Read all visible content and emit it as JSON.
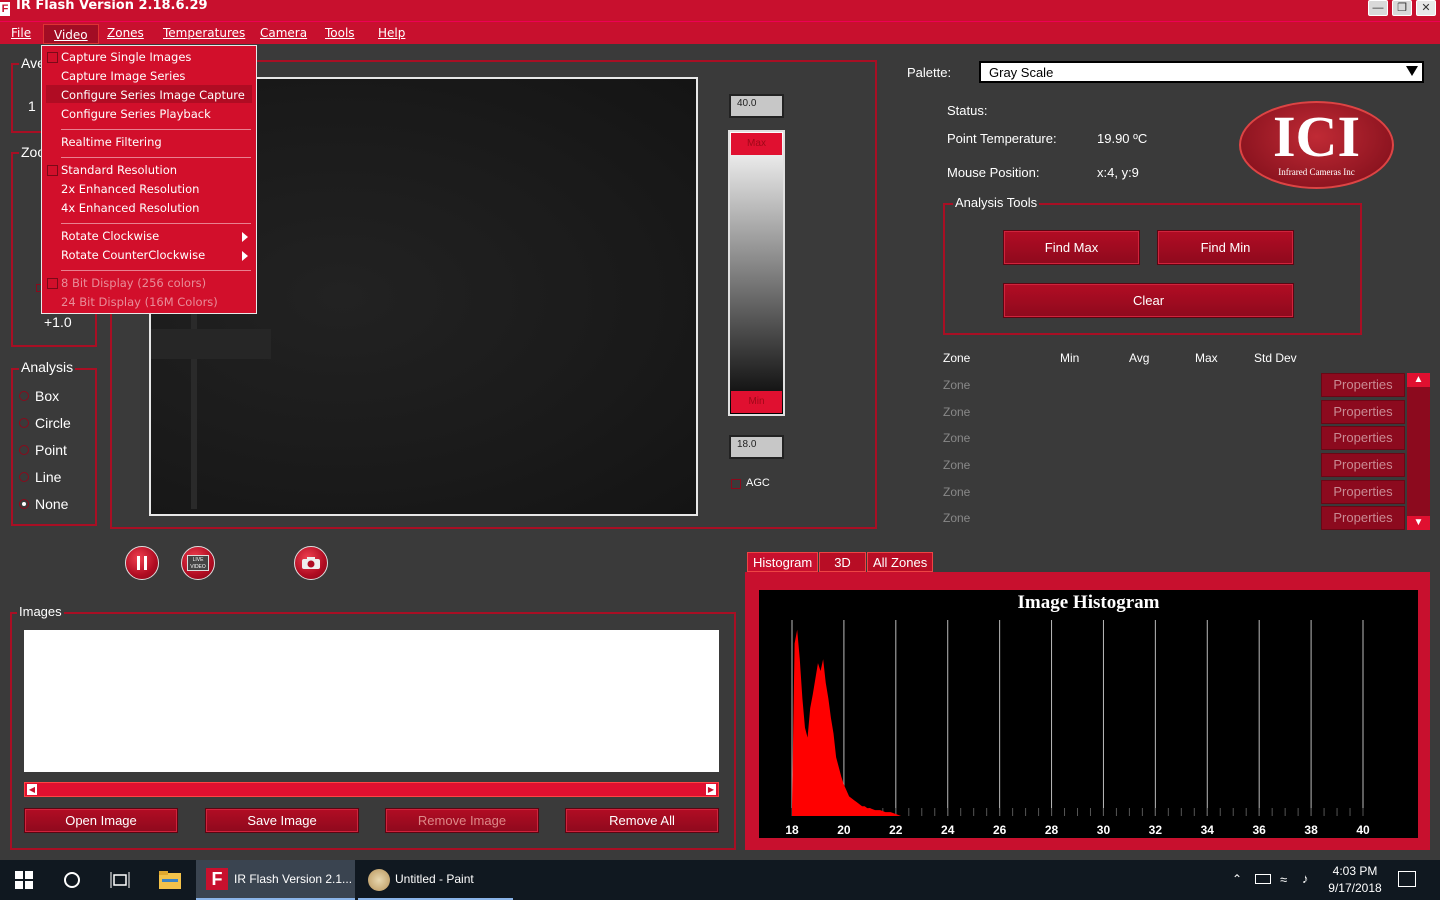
{
  "window": {
    "title": "IR Flash Version 2.18.6.29",
    "app_icon": "F"
  },
  "menubar": {
    "items": [
      "File",
      "Video",
      "Zones",
      "Temperatures",
      "Camera",
      "Tools",
      "Help"
    ]
  },
  "video_menu": {
    "items": [
      {
        "label": "Capture Single Images",
        "check": true,
        "disabled": false
      },
      {
        "label": "Capture Image Series",
        "check": false,
        "disabled": false
      },
      {
        "label": "Configure Series Image Capture",
        "check": false,
        "disabled": false,
        "highlighted": true
      },
      {
        "label": "Configure Series Playback",
        "check": false,
        "disabled": false
      },
      {
        "label": "Realtime Filtering",
        "check": false,
        "disabled": false
      },
      {
        "label": "Standard Resolution",
        "check": true,
        "disabled": false
      },
      {
        "label": "2x Enhanced Resolution",
        "check": false,
        "disabled": false
      },
      {
        "label": "4x Enhanced Resolution",
        "check": false,
        "disabled": false
      },
      {
        "label": "Rotate Clockwise",
        "check": false,
        "disabled": false,
        "submenu": true
      },
      {
        "label": "Rotate CounterClockwise",
        "check": false,
        "disabled": false,
        "submenu": true
      },
      {
        "label": "8 Bit Display (256 colors)",
        "check": true,
        "disabled": true
      },
      {
        "label": "24 Bit Display (16M Colors)",
        "check": false,
        "disabled": true
      }
    ]
  },
  "left_panel": {
    "ave_label": "Ave",
    "ave_value": "1",
    "zoom_label": "Zoo",
    "zoom_value": "+1.0",
    "analysis_label": "Analysis",
    "analysis_options": [
      "Box",
      "Circle",
      "Point",
      "Line",
      "None"
    ],
    "analysis_selected": "None"
  },
  "scale": {
    "max_value": "40.0",
    "min_value": "18.0",
    "max_label": "Max",
    "min_label": "Min",
    "agc_label": "AGC"
  },
  "palette": {
    "label": "Palette:",
    "value": "Gray Scale"
  },
  "status": {
    "status_label": "Status:",
    "point_temp_label": "Point Temperature:",
    "point_temp_value": "19.90 ºC",
    "mouse_pos_label": "Mouse Position:",
    "mouse_pos_value": "x:4, y:9"
  },
  "logo": {
    "text": "ICI",
    "subtitle": "Infrared Cameras Inc"
  },
  "analysis_tools": {
    "label": "Analysis Tools",
    "find_max": "Find Max",
    "find_min": "Find Min",
    "clear": "Clear"
  },
  "zone_table": {
    "headers": [
      "Zone",
      "Min",
      "Avg",
      "Max",
      "Std Dev"
    ],
    "rows": [
      "Zone",
      "Zone",
      "Zone",
      "Zone",
      "Zone",
      "Zone"
    ],
    "properties_label": "Properties"
  },
  "controls": {
    "pause_icon": "pause-icon",
    "live_icon": "LIVE VIDEO",
    "camera_icon": "camera-icon"
  },
  "images": {
    "label": "Images",
    "open": "Open Image",
    "save": "Save Image",
    "remove": "Remove Image",
    "remove_all": "Remove All"
  },
  "tabs": {
    "items": [
      "Histogram",
      "3D",
      "All Zones"
    ],
    "active": "Histogram"
  },
  "chart_data": {
    "type": "area",
    "title": "Image Histogram",
    "xlabel": "",
    "ylabel": "",
    "x_ticks": [
      18,
      20,
      22,
      24,
      26,
      28,
      30,
      32,
      34,
      36,
      38,
      40
    ],
    "xlim": [
      18,
      40
    ],
    "ylim": [
      0,
      1
    ],
    "grid": true,
    "color": "#ff0000",
    "x": [
      18,
      18.1,
      18.2,
      18.3,
      18.4,
      18.5,
      18.6,
      18.7,
      18.8,
      18.9,
      19.0,
      19.1,
      19.2,
      19.3,
      19.4,
      19.5,
      19.6,
      19.7,
      19.8,
      19.9,
      20.0,
      20.1,
      20.2,
      20.3,
      20.4,
      20.5,
      20.6,
      20.7,
      20.8,
      20.9,
      21.0,
      21.2,
      21.4,
      21.6,
      21.8,
      22.0,
      22.2
    ],
    "y": [
      0.05,
      0.88,
      0.95,
      0.8,
      0.6,
      0.45,
      0.4,
      0.55,
      0.62,
      0.7,
      0.78,
      0.74,
      0.8,
      0.68,
      0.6,
      0.5,
      0.42,
      0.3,
      0.25,
      0.2,
      0.16,
      0.13,
      0.1,
      0.09,
      0.08,
      0.07,
      0.06,
      0.05,
      0.05,
      0.04,
      0.04,
      0.03,
      0.03,
      0.02,
      0.02,
      0.01,
      0.0
    ]
  },
  "taskbar": {
    "apps": [
      {
        "label": "IR Flash Version 2.1..."
      },
      {
        "label": "Untitled - Paint"
      }
    ],
    "time": "4:03 PM",
    "date": "9/17/2018"
  }
}
